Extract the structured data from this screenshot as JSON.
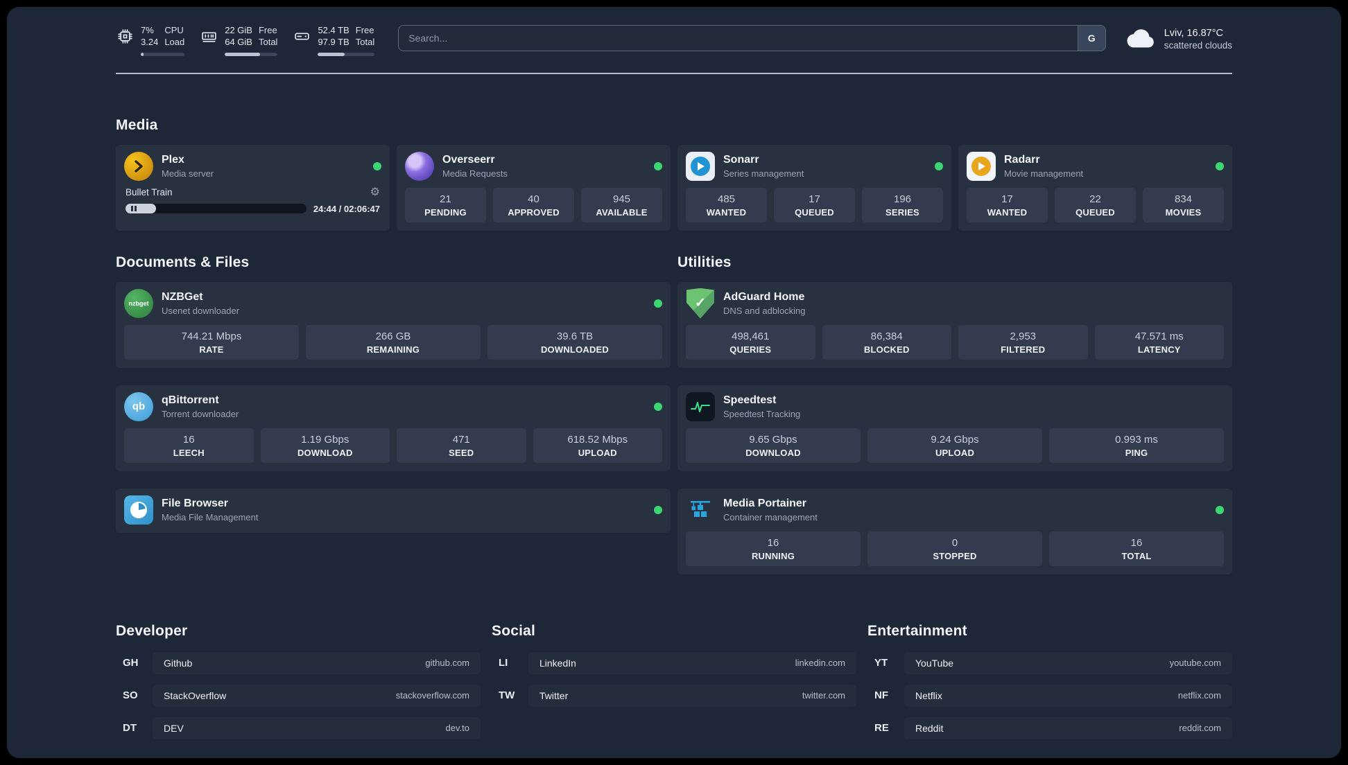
{
  "topbar": {
    "metrics": [
      {
        "name": "cpu",
        "value": "7%",
        "value2": "3.24",
        "label": "CPU",
        "label2": "Load",
        "progress": 7
      },
      {
        "name": "ram",
        "value": "22 GiB",
        "value2": "64 GiB",
        "label": "Free",
        "label2": "Total",
        "progress": 66
      },
      {
        "name": "disk",
        "value": "52.4 TB",
        "value2": "97.9 TB",
        "label": "Free",
        "label2": "Total",
        "progress": 47
      }
    ],
    "search": {
      "placeholder": "Search...",
      "button": "G"
    },
    "weather": {
      "location": "Lviv, 16.87°C",
      "condition": "scattered clouds"
    }
  },
  "sections": {
    "media": {
      "title": "Media",
      "cards": [
        {
          "name": "Plex",
          "subtitle": "Media server",
          "online": true,
          "player": {
            "title": "Bullet Train",
            "time": "24:44 / 02:06:47",
            "progress": 17
          }
        },
        {
          "name": "Overseerr",
          "subtitle": "Media Requests",
          "online": true,
          "stats": [
            {
              "value": "21",
              "label": "PENDING"
            },
            {
              "value": "40",
              "label": "APPROVED"
            },
            {
              "value": "945",
              "label": "AVAILABLE"
            }
          ]
        },
        {
          "name": "Sonarr",
          "subtitle": "Series management",
          "online": true,
          "stats": [
            {
              "value": "485",
              "label": "WANTED"
            },
            {
              "value": "17",
              "label": "QUEUED"
            },
            {
              "value": "196",
              "label": "SERIES"
            }
          ]
        },
        {
          "name": "Radarr",
          "subtitle": "Movie management",
          "online": true,
          "stats": [
            {
              "value": "17",
              "label": "WANTED"
            },
            {
              "value": "22",
              "label": "QUEUED"
            },
            {
              "value": "834",
              "label": "MOVIES"
            }
          ]
        }
      ]
    },
    "documents": {
      "title": "Documents & Files",
      "cards": [
        {
          "name": "NZBGet",
          "subtitle": "Usenet downloader",
          "online": true,
          "stats": [
            {
              "value": "744.21 Mbps",
              "label": "RATE"
            },
            {
              "value": "266 GB",
              "label": "REMAINING"
            },
            {
              "value": "39.6 TB",
              "label": "DOWNLOADED"
            }
          ]
        },
        {
          "name": "qBittorrent",
          "subtitle": "Torrent downloader",
          "online": true,
          "stats": [
            {
              "value": "16",
              "label": "LEECH"
            },
            {
              "value": "1.19 Gbps",
              "label": "DOWNLOAD"
            },
            {
              "value": "471",
              "label": "SEED"
            },
            {
              "value": "618.52 Mbps",
              "label": "UPLOAD"
            }
          ]
        },
        {
          "name": "File Browser",
          "subtitle": "Media File Management",
          "online": true
        }
      ]
    },
    "utilities": {
      "title": "Utilities",
      "cards": [
        {
          "name": "AdGuard Home",
          "subtitle": "DNS and adblocking",
          "stats": [
            {
              "value": "498,461",
              "label": "QUERIES"
            },
            {
              "value": "86,384",
              "label": "BLOCKED"
            },
            {
              "value": "2,953",
              "label": "FILTERED"
            },
            {
              "value": "47.571 ms",
              "label": "LATENCY"
            }
          ]
        },
        {
          "name": "Speedtest",
          "subtitle": "Speedtest Tracking",
          "stats": [
            {
              "value": "9.65 Gbps",
              "label": "DOWNLOAD"
            },
            {
              "value": "9.24 Gbps",
              "label": "UPLOAD"
            },
            {
              "value": "0.993 ms",
              "label": "PING"
            }
          ]
        },
        {
          "name": "Media Portainer",
          "subtitle": "Container management",
          "online": true,
          "stats": [
            {
              "value": "16",
              "label": "RUNNING"
            },
            {
              "value": "0",
              "label": "STOPPED"
            },
            {
              "value": "16",
              "label": "TOTAL"
            }
          ]
        }
      ]
    },
    "bookmarks": [
      {
        "title": "Developer",
        "links": [
          {
            "abbr": "GH",
            "name": "Github",
            "url": "github.com"
          },
          {
            "abbr": "SO",
            "name": "StackOverflow",
            "url": "stackoverflow.com"
          },
          {
            "abbr": "DT",
            "name": "DEV",
            "url": "dev.to"
          }
        ]
      },
      {
        "title": "Social",
        "links": [
          {
            "abbr": "LI",
            "name": "LinkedIn",
            "url": "linkedin.com"
          },
          {
            "abbr": "TW",
            "name": "Twitter",
            "url": "twitter.com"
          }
        ]
      },
      {
        "title": "Entertainment",
        "links": [
          {
            "abbr": "YT",
            "name": "YouTube",
            "url": "youtube.com"
          },
          {
            "abbr": "NF",
            "name": "Netflix",
            "url": "netflix.com"
          },
          {
            "abbr": "RE",
            "name": "Reddit",
            "url": "reddit.com"
          }
        ]
      }
    ]
  },
  "icons": {
    "cpu": "chip",
    "ram": "memory-stick",
    "disk": "hard-drive",
    "weather": "cloud",
    "gear": "⚙",
    "pause": "pause-bars",
    "nzbget_text": "nzbget",
    "qbittorrent_text": "qb",
    "adguard_check": "✓"
  },
  "colors": {
    "background": "#1d2737",
    "card": "#27313f",
    "stat_tile": "#323c4e",
    "status_online": "#3bd671",
    "plex_amber": "#e5a00d",
    "overseerr_purple": "#5f4bc2",
    "adguard_green": "#63bb6d",
    "portainer_blue": "#28a5dd",
    "speedtest_green": "#35e08e"
  }
}
